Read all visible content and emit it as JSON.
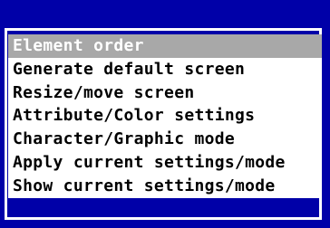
{
  "menu": {
    "items": [
      {
        "label": "Element order",
        "selected": true
      },
      {
        "label": "Generate default screen",
        "selected": false
      },
      {
        "label": "Resize/move screen",
        "selected": false
      },
      {
        "label": "Attribute/Color settings",
        "selected": false
      },
      {
        "label": "Character/Graphic mode",
        "selected": false
      },
      {
        "label": "Apply current settings/mode",
        "selected": false
      },
      {
        "label": "Show current settings/mode",
        "selected": false
      }
    ]
  },
  "colors": {
    "background": "#0000a8",
    "frame": "#ffffff",
    "item_background": "#ffffff",
    "item_text": "#000000",
    "selected_background": "#a8a8a8",
    "selected_text": "#ffffff"
  }
}
